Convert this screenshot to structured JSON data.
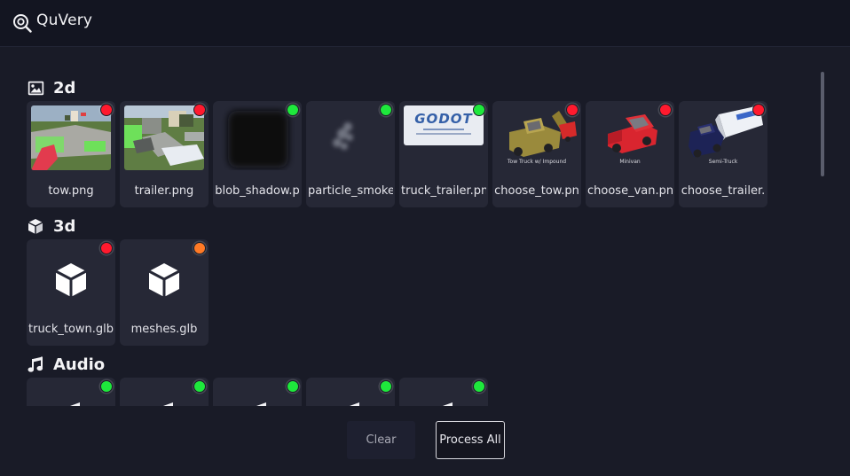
{
  "app": {
    "title": "QuVery"
  },
  "sections": [
    {
      "title": "2d",
      "icon": "image-icon",
      "items": [
        {
          "label": "tow.png",
          "status": "red",
          "thumb": "scene-tow"
        },
        {
          "label": "trailer.png",
          "status": "red",
          "thumb": "scene-trailer"
        },
        {
          "label": "blob_shadow.p",
          "status": "green",
          "thumb": "blob-shadow"
        },
        {
          "label": "particle_smoke",
          "status": "green",
          "thumb": "smoke"
        },
        {
          "label": "truck_trailer.pn",
          "status": "green",
          "thumb": "godot-trailer",
          "thumb_text": "GODOT"
        },
        {
          "label": "choose_tow.pn",
          "status": "red",
          "thumb": "tow-truck",
          "thumb_text": "Tow Truck w/ Impound"
        },
        {
          "label": "choose_van.pn",
          "status": "red",
          "thumb": "minivan",
          "thumb_text": "Minivan"
        },
        {
          "label": "choose_trailer.",
          "status": "red",
          "thumb": "semi-truck",
          "thumb_text": "Semi-Truck"
        }
      ]
    },
    {
      "title": "3d",
      "icon": "cube-icon",
      "items": [
        {
          "label": "truck_town.glb",
          "status": "red",
          "thumb": "cube-icon"
        },
        {
          "label": "meshes.glb",
          "status": "orange",
          "thumb": "cube-icon"
        }
      ]
    },
    {
      "title": "Audio",
      "icon": "music-note-icon",
      "items": [
        {
          "label": "",
          "status": "green",
          "thumb": "audio"
        },
        {
          "label": "",
          "status": "green",
          "thumb": "audio"
        },
        {
          "label": "",
          "status": "green",
          "thumb": "audio"
        },
        {
          "label": "",
          "status": "green",
          "thumb": "audio"
        },
        {
          "label": "",
          "status": "green",
          "thumb": "audio"
        }
      ]
    }
  ],
  "buttons": {
    "clear": "Clear",
    "process_all": "Process All"
  },
  "colors": {
    "status_red": "#ff1a2e",
    "status_green": "#1ee83c",
    "status_orange": "#ff7a26",
    "tile_bg": "#262836",
    "panel_bg": "#191b27"
  }
}
